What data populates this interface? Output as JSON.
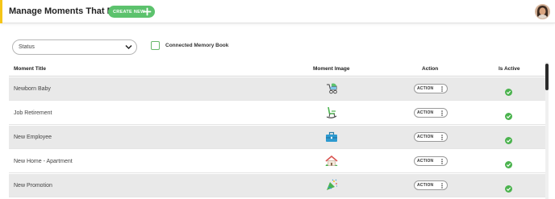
{
  "header": {
    "title": "Manage Moments That Matter",
    "create_label": "CREATE NEW",
    "accent_color": "#f5c518",
    "create_color": "#5cc26d"
  },
  "filters": {
    "status_label": "Status",
    "checkbox_label": "Connected Memory Book"
  },
  "table": {
    "columns": [
      "Moment Title",
      "Moment Image",
      "Action",
      "Is Active"
    ],
    "rows": [
      {
        "title": "Newborn Baby",
        "icon": "baby-stroller-icon",
        "action": "ACTION",
        "active": true
      },
      {
        "title": "Job Retirement",
        "icon": "rocking-chair-icon",
        "action": "ACTION",
        "active": true
      },
      {
        "title": "New Employee",
        "icon": "briefcase-icon",
        "action": "ACTION",
        "active": true
      },
      {
        "title": "New Home - Apartment",
        "icon": "house-icon",
        "action": "ACTION",
        "active": true
      },
      {
        "title": "New Promotion",
        "icon": "party-popper-icon",
        "action": "ACTION",
        "active": true
      }
    ]
  }
}
